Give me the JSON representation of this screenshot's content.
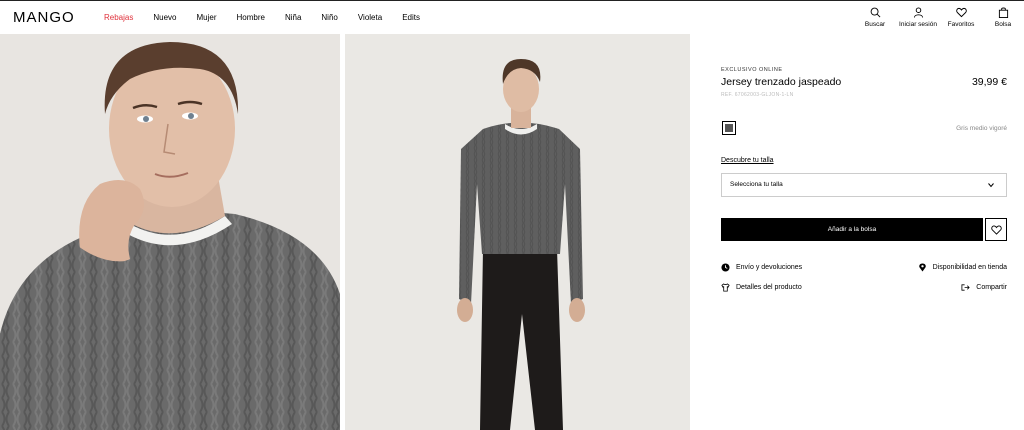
{
  "brand": {
    "logo": "MANGO"
  },
  "nav": {
    "items": [
      {
        "label": "Rebajas",
        "sale": true
      },
      {
        "label": "Nuevo"
      },
      {
        "label": "Mujer"
      },
      {
        "label": "Hombre"
      },
      {
        "label": "Niña"
      },
      {
        "label": "Niño"
      },
      {
        "label": "Violeta"
      },
      {
        "label": "Edits"
      }
    ]
  },
  "tools": [
    {
      "label": "Buscar",
      "icon": "search-icon"
    },
    {
      "label": "Iniciar sesión",
      "icon": "user-icon"
    },
    {
      "label": "Favoritos",
      "icon": "heart-icon"
    },
    {
      "label": "Bolsa",
      "icon": "bag-icon"
    }
  ],
  "product": {
    "badge": "EXCLUSIVO ONLINE",
    "title": "Jersey trenzado jaspeado",
    "ref": "REF. 67062003-GLJON-1-LN",
    "price": "39,99 €",
    "color_name": "Gris medio vigoré",
    "swatch_color": "#555555",
    "size_guide": "Descubre tu talla",
    "size_placeholder": "Selecciona tu talla",
    "add_to_bag": "Añadir a la bolsa"
  },
  "info_links": {
    "shipping": "Envío y devoluciones",
    "details": "Detalles del producto",
    "availability": "Disponibilidad en tienda",
    "share": "Compartir"
  },
  "colors": {
    "sale": "#e0323c",
    "button": "#000000"
  }
}
